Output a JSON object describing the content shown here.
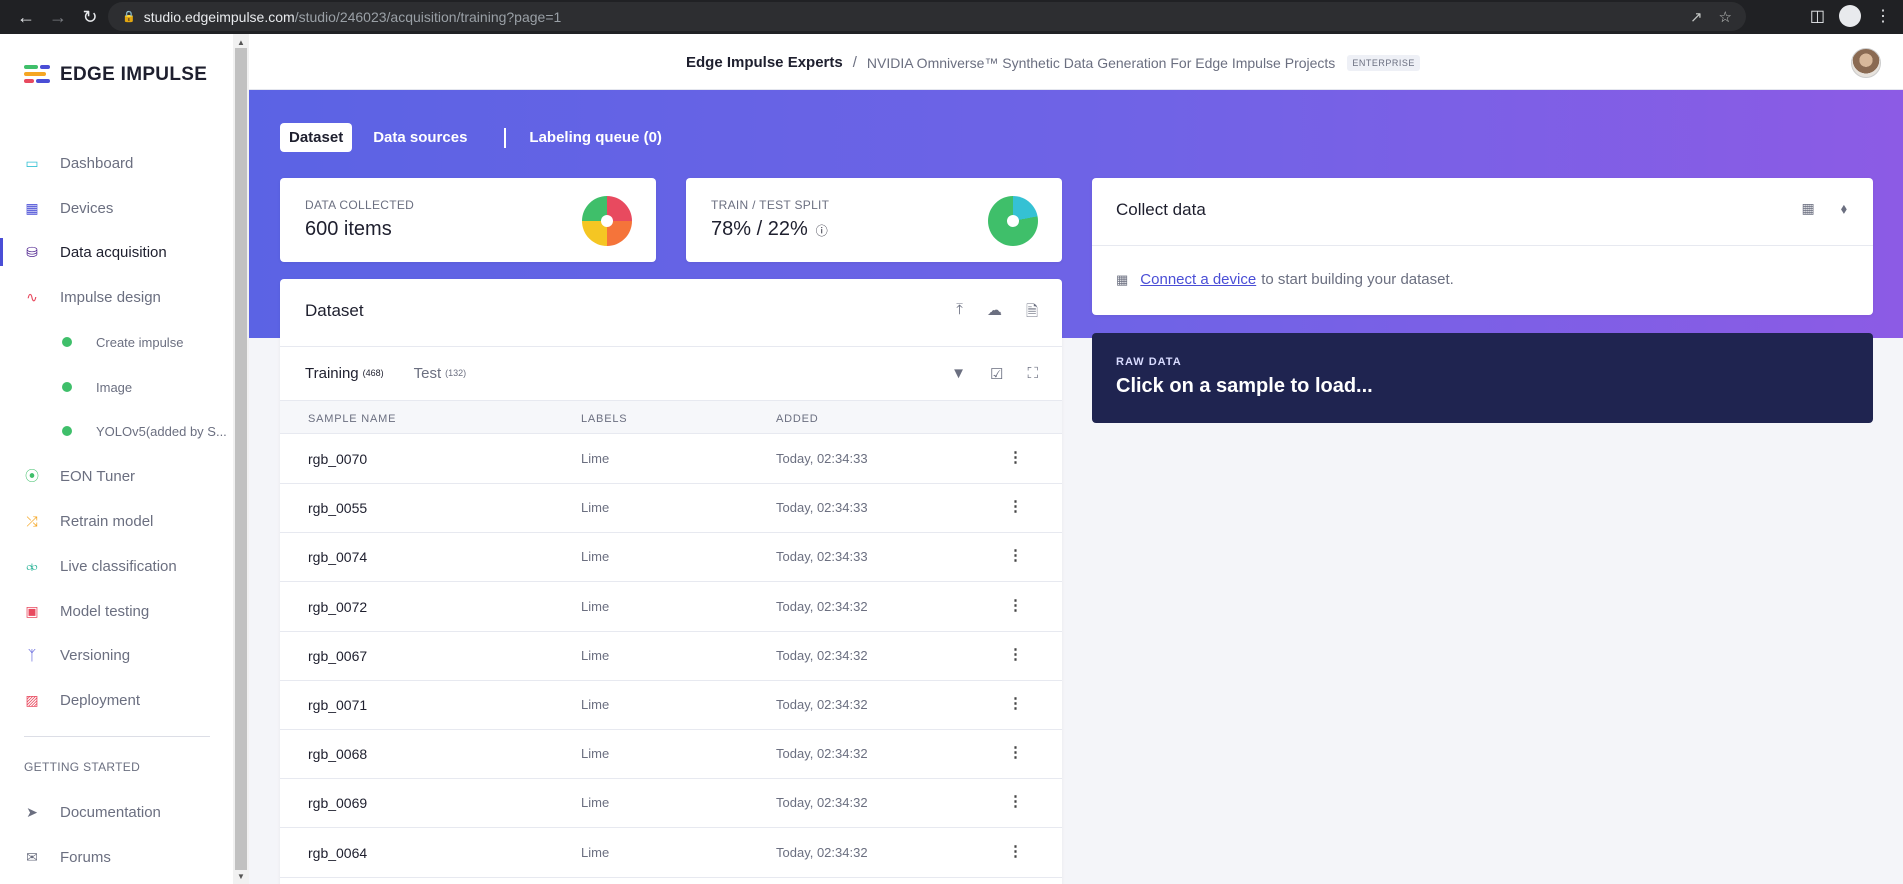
{
  "browser": {
    "url_host": "studio.edgeimpulse.com",
    "url_path": "/studio/246023/acquisition/training?page=1"
  },
  "app": {
    "logo_text": "EDGE IMPULSE"
  },
  "sidebar": {
    "items": [
      {
        "label": "Dashboard",
        "icon": "monitor-icon"
      },
      {
        "label": "Devices",
        "icon": "chip-icon"
      },
      {
        "label": "Data acquisition",
        "icon": "database-icon",
        "active": true
      },
      {
        "label": "Impulse design",
        "icon": "pulse-icon"
      },
      {
        "label": "Create impulse",
        "sub": true
      },
      {
        "label": "Image",
        "sub": true
      },
      {
        "label": "YOLOv5(added by S...",
        "sub": true
      },
      {
        "label": "EON Tuner",
        "icon": "compass-icon"
      },
      {
        "label": "Retrain model",
        "icon": "shuffle-icon"
      },
      {
        "label": "Live classification",
        "icon": "broadcast-icon"
      },
      {
        "label": "Model testing",
        "icon": "clipboard-icon"
      },
      {
        "label": "Versioning",
        "icon": "branch-icon"
      },
      {
        "label": "Deployment",
        "icon": "box-icon"
      }
    ],
    "section_label": "GETTING STARTED",
    "footer_items": [
      {
        "label": "Documentation",
        "icon": "rocket-icon"
      },
      {
        "label": "Forums",
        "icon": "chat-icon"
      }
    ]
  },
  "header": {
    "org": "Edge Impulse Experts",
    "separator": "/",
    "project": "NVIDIA Omniverse™ Synthetic Data Generation For Edge Impulse Projects",
    "badge": "ENTERPRISE"
  },
  "tabs": [
    {
      "label": "Dataset",
      "active": true
    },
    {
      "label": "Data sources"
    },
    {
      "label": "Labeling queue (0)"
    }
  ],
  "stats": {
    "collected_label": "DATA COLLECTED",
    "collected_value": "600 items",
    "split_label": "TRAIN / TEST SPLIT",
    "split_value": "78% / 22%",
    "split_help": "?",
    "train_fraction": 0.78
  },
  "dataset": {
    "title": "Dataset",
    "training_tab": "Training",
    "training_count": "(468)",
    "test_tab": "Test",
    "test_count": "(132)",
    "columns": [
      "SAMPLE NAME",
      "LABELS",
      "ADDED"
    ],
    "rows": [
      {
        "name": "rgb_0070",
        "label": "Lime",
        "added": "Today, 02:34:33"
      },
      {
        "name": "rgb_0055",
        "label": "Lime",
        "added": "Today, 02:34:33"
      },
      {
        "name": "rgb_0074",
        "label": "Lime",
        "added": "Today, 02:34:33"
      },
      {
        "name": "rgb_0072",
        "label": "Lime",
        "added": "Today, 02:34:32"
      },
      {
        "name": "rgb_0067",
        "label": "Lime",
        "added": "Today, 02:34:32"
      },
      {
        "name": "rgb_0071",
        "label": "Lime",
        "added": "Today, 02:34:32"
      },
      {
        "name": "rgb_0068",
        "label": "Lime",
        "added": "Today, 02:34:32"
      },
      {
        "name": "rgb_0069",
        "label": "Lime",
        "added": "Today, 02:34:32"
      },
      {
        "name": "rgb_0064",
        "label": "Lime",
        "added": "Today, 02:34:32"
      }
    ]
  },
  "collect": {
    "title": "Collect data",
    "link": "Connect a device",
    "message": "to start building your dataset."
  },
  "raw": {
    "caption": "RAW DATA",
    "message": "Click on a sample to load..."
  },
  "colors": {
    "accent": "#4a4ed6",
    "hero_start": "#5b63e4",
    "hero_end": "#8c5be5",
    "raw_bg": "#1f2450",
    "dot_green": "#3fbf6a"
  }
}
